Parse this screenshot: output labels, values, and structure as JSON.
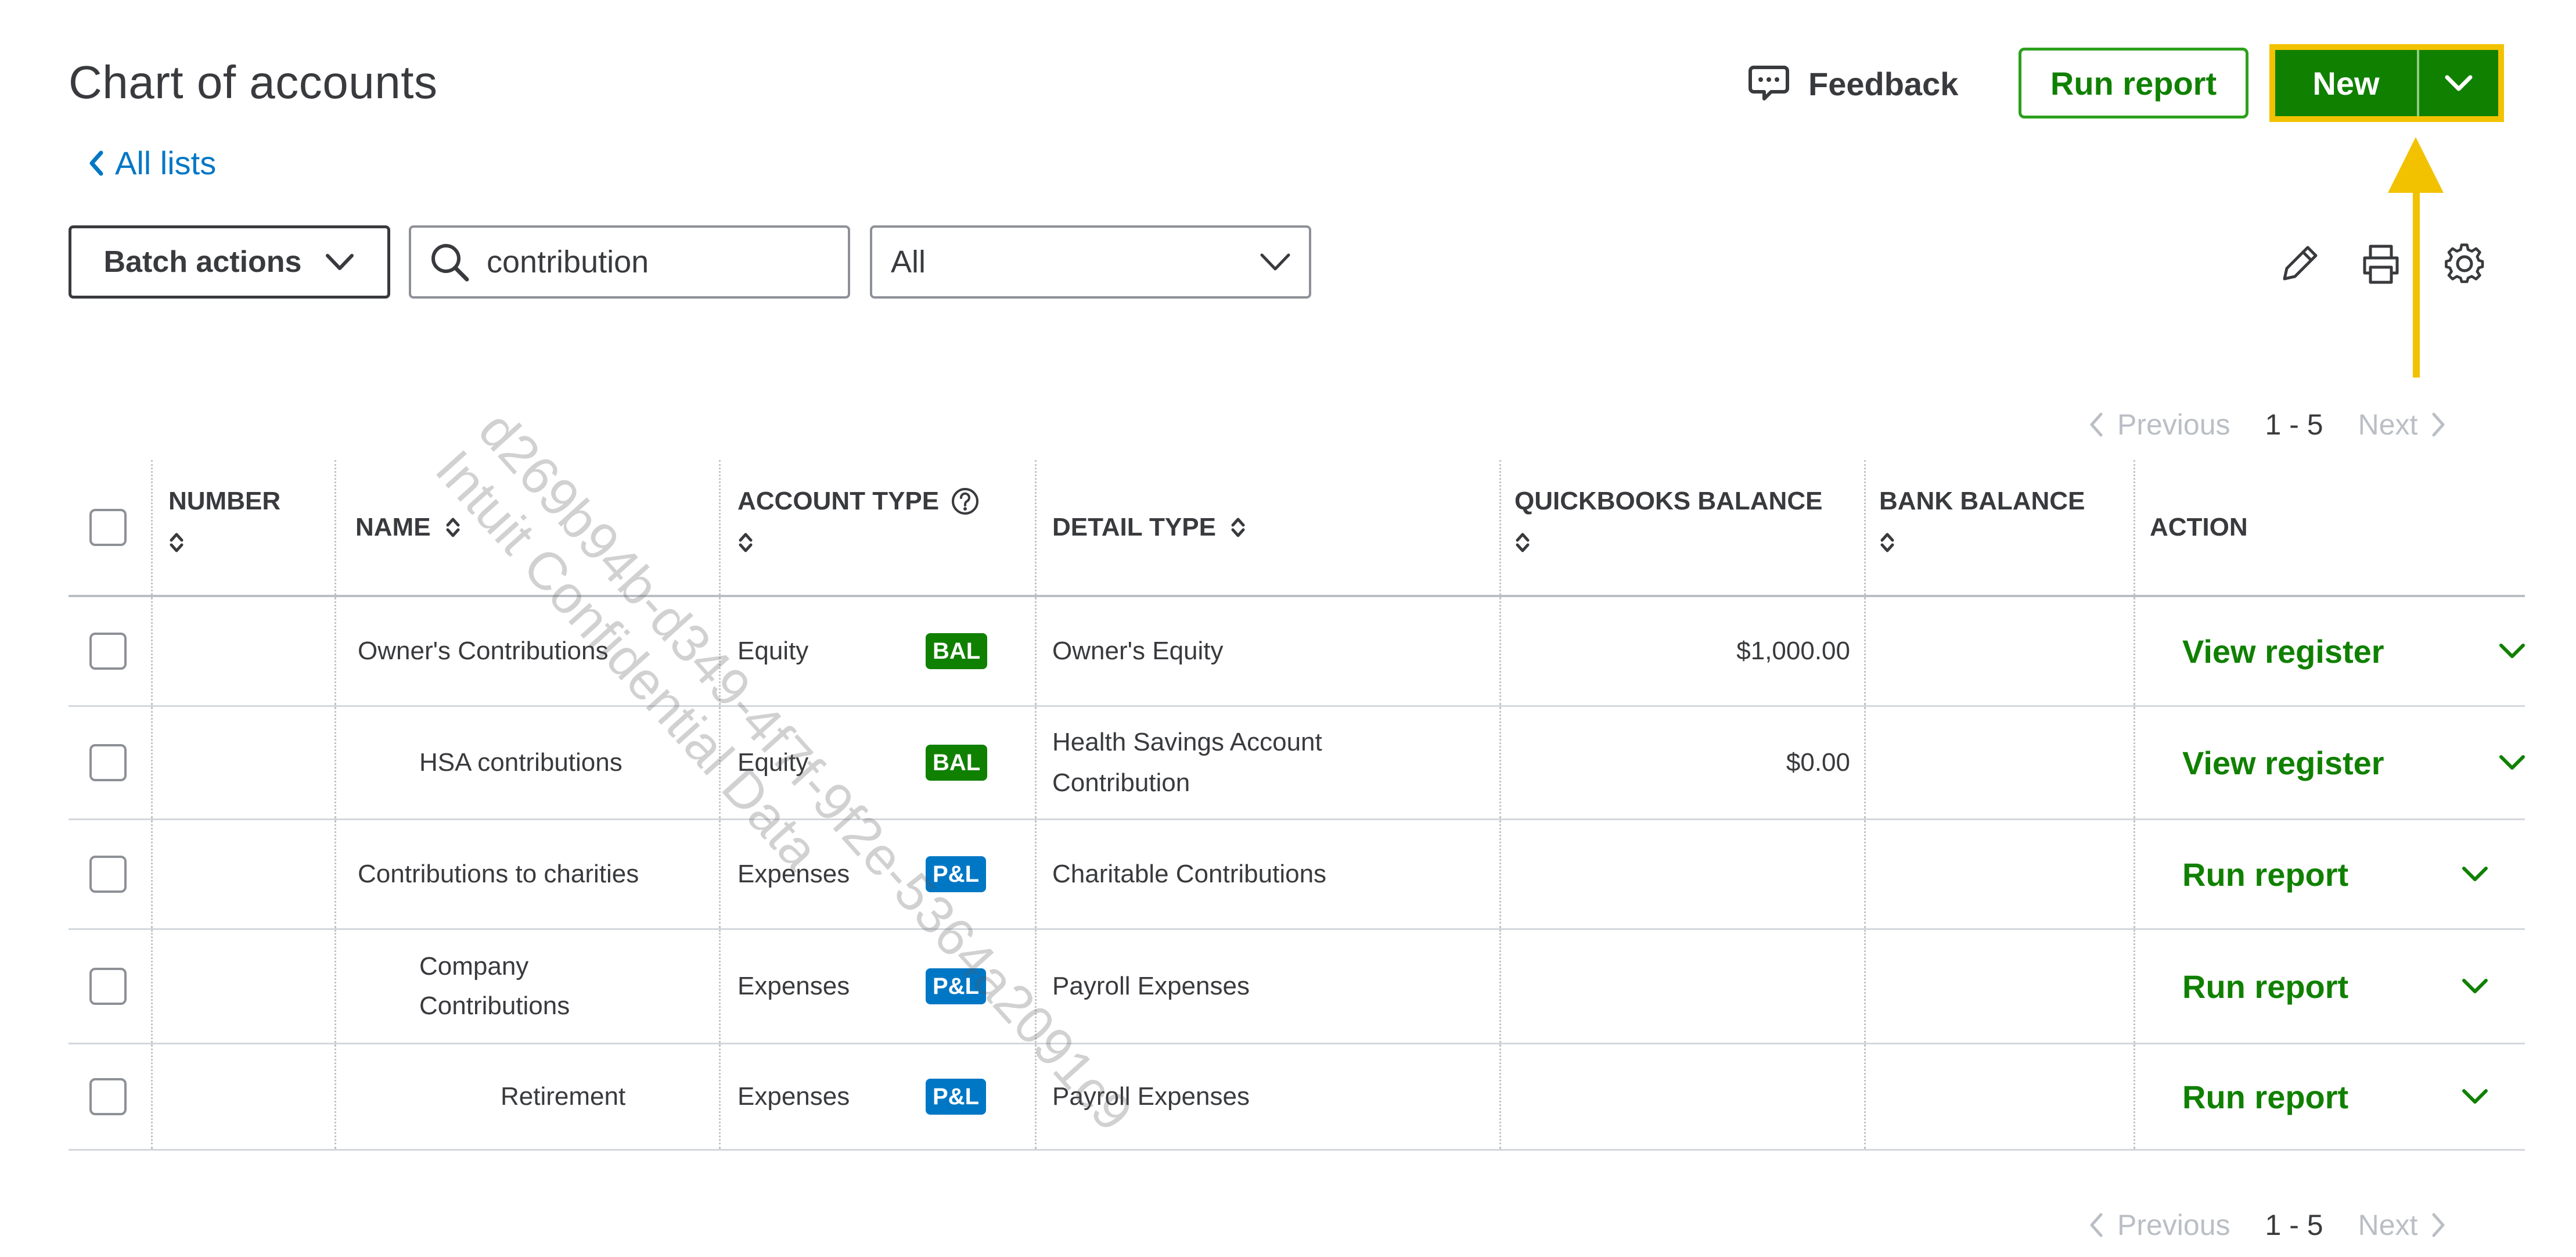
{
  "page": {
    "title": "Chart of accounts",
    "back_link": "All lists",
    "feedback_label": "Feedback",
    "run_report_label": "Run report",
    "new_label": "New"
  },
  "toolbar": {
    "batch_actions_label": "Batch actions",
    "search_value": "contribution",
    "filter_value": "All"
  },
  "pagination": {
    "previous": "Previous",
    "range": "1 - 5",
    "next": "Next"
  },
  "table": {
    "columns": {
      "number": "NUMBER",
      "name": "NAME",
      "account_type": "ACCOUNT TYPE",
      "detail_type": "DETAIL TYPE",
      "quickbooks_balance": "QUICKBOOKS BALANCE",
      "bank_balance": "BANK BALANCE",
      "action": "ACTION"
    },
    "rows": [
      {
        "name": "Owner's Contributions",
        "account_type": "Equity",
        "badge": "BAL",
        "detail_1": "Owner's Equity",
        "detail_2": "",
        "qb_balance": "$1,000.00",
        "bank_balance": "",
        "action": "View register"
      },
      {
        "name": "HSA contributions",
        "account_type": "Equity",
        "badge": "BAL",
        "detail_1": "Health Savings Account",
        "detail_2": "Contribution",
        "qb_balance": "$0.00",
        "bank_balance": "",
        "action": "View register"
      },
      {
        "name": "Contributions to charities",
        "account_type": "Expenses",
        "badge": "P&L",
        "detail_1": "Charitable Contributions",
        "detail_2": "",
        "qb_balance": "",
        "bank_balance": "",
        "action": "Run report"
      },
      {
        "name": "Company",
        "name_2": "Contributions",
        "account_type": "Expenses",
        "badge": "P&L",
        "detail_1": "Payroll Expenses",
        "detail_2": "",
        "qb_balance": "",
        "bank_balance": "",
        "action": "Run report"
      },
      {
        "name": "Retirement",
        "account_type": "Expenses",
        "badge": "P&L",
        "detail_1": "Payroll Expenses",
        "detail_2": "",
        "qb_balance": "",
        "bank_balance": "",
        "action": "Run report"
      }
    ]
  },
  "watermark": {
    "line1": "d269b94b-d349-4f7f-9f2e-5364a2091c9",
    "line2": "Intuit Confidential Data"
  },
  "colors": {
    "brand_green": "#108000",
    "highlight_yellow": "#f2c200",
    "bal_badge": "#108000",
    "pl_badge": "#0077c5",
    "link_blue": "#0077c5"
  },
  "icons": [
    "chevron-left-icon",
    "feedback-icon",
    "chevron-down-icon",
    "search-icon",
    "pencil-icon",
    "printer-icon",
    "gear-icon",
    "sort-icon",
    "help-circle-icon"
  ]
}
